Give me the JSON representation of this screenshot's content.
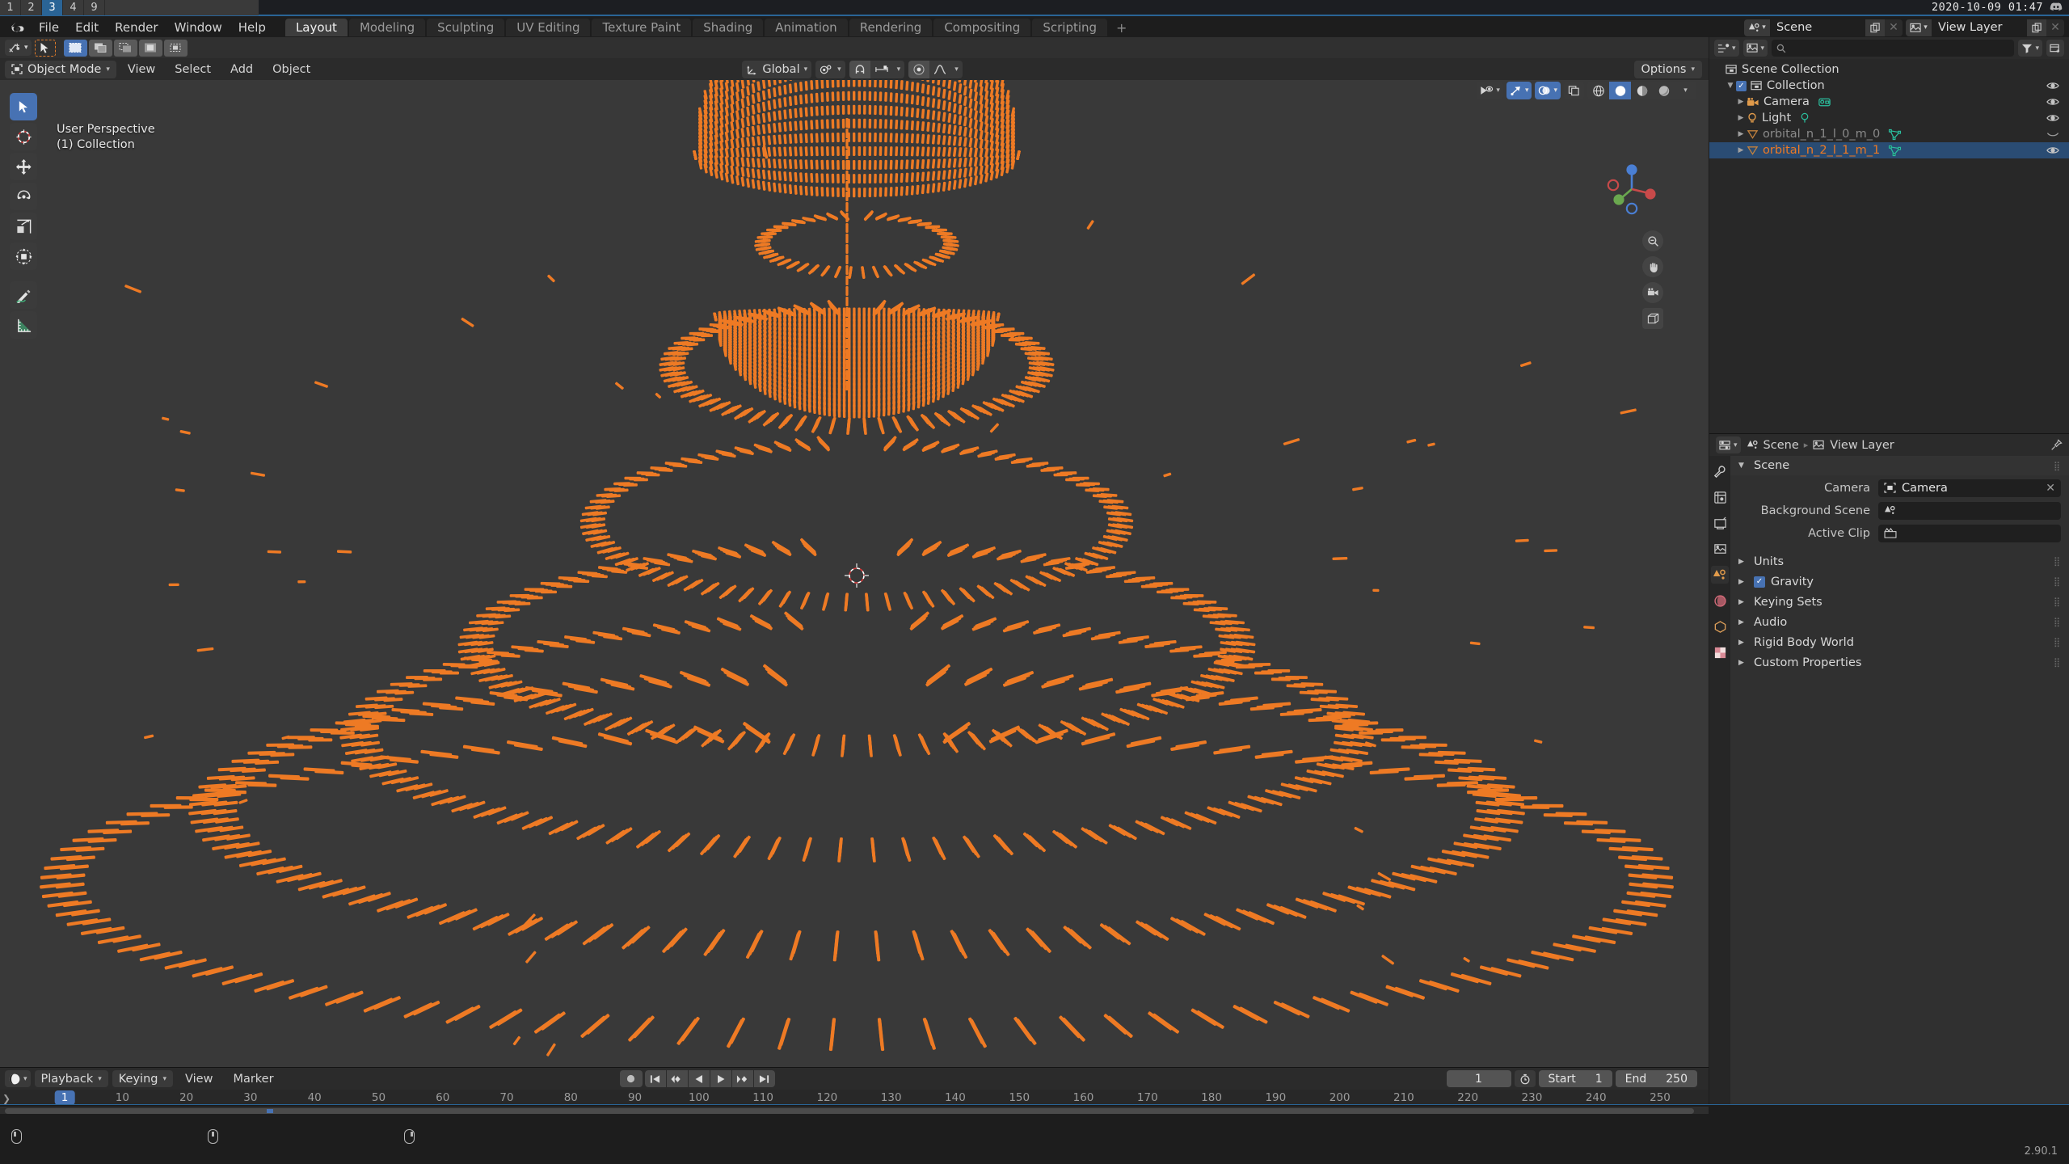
{
  "os_bar": {
    "workspaces": [
      "1",
      "2",
      "3",
      "4",
      "9"
    ],
    "active_workspace": "3",
    "clock": "2020-10-09 01:47",
    "tray_icon": "discord-icon"
  },
  "topbar": {
    "logo": "blender-logo",
    "menus": [
      "File",
      "Edit",
      "Render",
      "Window",
      "Help"
    ],
    "workspace_tabs": [
      "Layout",
      "Modeling",
      "Sculpting",
      "UV Editing",
      "Texture Paint",
      "Shading",
      "Animation",
      "Rendering",
      "Compositing",
      "Scripting"
    ],
    "active_workspace_tab": "Layout",
    "add_workspace": "+",
    "scene_selector": {
      "icon": "scene-icon",
      "value": "Scene",
      "new_btn": "duplicate-icon",
      "unlink_btn": "x-icon"
    },
    "viewlayer_selector": {
      "icon": "viewlayer-icon",
      "value": "View Layer",
      "new_btn": "duplicate-icon",
      "unlink_btn": "x-icon"
    }
  },
  "viewport": {
    "tool_row": {
      "cursor_dropdown_icon": "cursor-add-icon",
      "active_tool_icon": "tweak-cursor-icon",
      "select_modes": [
        "set-select-icon",
        "extend-select-icon",
        "subtract-select-icon",
        "invert-select-icon",
        "intersect-select-icon"
      ],
      "active_select_mode": 0
    },
    "header": {
      "mode": "Object Mode",
      "menus": [
        "View",
        "Select",
        "Add",
        "Object"
      ],
      "transform_orientation": "Global",
      "pivot_icon": "pivot-point-icon",
      "snap_icon": "magnet-icon",
      "snap_target_icon": "snap-increment-icon",
      "proportional_icon": "proportional-edit-icon",
      "falloff_icon": "smooth-falloff-icon",
      "options_label": "Options",
      "visibility_icon": "object-types-visibility-icon",
      "gizmo_icon": "gizmo-icon",
      "overlays_icon": "overlays-icon",
      "xray_icon": "xray-icon",
      "shading_modes": [
        "wireframe-icon",
        "solid-icon",
        "material-preview-icon",
        "rendered-icon"
      ],
      "active_shading_mode": 1
    },
    "overlay_text_line1": "User Perspective",
    "overlay_text_line2": "(1) Collection",
    "toolbar_tools": [
      "tweak-tool-icon",
      "cursor-tool-icon",
      "move-tool-icon",
      "rotate-tool-icon",
      "scale-tool-icon",
      "transform-tool-icon",
      "annotate-tool-icon",
      "measure-tool-icon"
    ],
    "active_toolbar_tool": 0,
    "nav_buttons": [
      "zoom-icon",
      "pan-hand-icon",
      "camera-view-icon",
      "ortho-persp-toggle-icon"
    ],
    "gizmo_axes": [
      "X",
      "Y",
      "Z"
    ],
    "object_color": "#ee7a24",
    "background_color": "#393939",
    "cursor_3d": "3d-cursor-icon"
  },
  "outliner": {
    "editor_icon": "outliner-editor-icon",
    "display_mode_icon": "view-layer-icon",
    "search_placeholder": "",
    "search_icon": "search-icon",
    "filter_icon": "filter-icon",
    "new_collection_icon": "new-collection-icon",
    "rows": [
      {
        "name": "Scene Collection",
        "icon": "scene-collection-icon",
        "indent": 0,
        "has_tri": false,
        "has_checkbox": false,
        "eye": false,
        "selected": false,
        "dim": false,
        "data_icon": ""
      },
      {
        "name": "Collection",
        "icon": "collection-icon",
        "indent": 1,
        "has_tri": true,
        "has_checkbox": true,
        "eye": true,
        "selected": false,
        "dim": false,
        "data_icon": ""
      },
      {
        "name": "Camera",
        "icon": "camera-object-icon",
        "indent": 2,
        "has_tri": true,
        "has_checkbox": false,
        "eye": true,
        "selected": false,
        "dim": false,
        "data_icon": "camera-data-icon"
      },
      {
        "name": "Light",
        "icon": "light-object-icon",
        "indent": 2,
        "has_tri": true,
        "has_checkbox": false,
        "eye": true,
        "selected": false,
        "dim": false,
        "data_icon": "light-data-icon"
      },
      {
        "name": "orbital_n_1_l_0_m_0",
        "icon": "mesh-object-icon",
        "indent": 2,
        "has_tri": true,
        "has_checkbox": false,
        "eye": false,
        "eye_closed": true,
        "selected": false,
        "dim": true,
        "data_icon": "mesh-data-icon"
      },
      {
        "name": "orbital_n_2_l_1_m_1",
        "icon": "mesh-object-icon",
        "indent": 2,
        "has_tri": true,
        "has_checkbox": false,
        "eye": true,
        "selected": true,
        "dim": false,
        "data_icon": "mesh-data-icon"
      }
    ]
  },
  "properties": {
    "editor_icon": "properties-editor-icon",
    "breadcrumb": [
      "Scene",
      "View Layer"
    ],
    "pin_icon": "pin-icon",
    "tabs": [
      "tool-tab-icon",
      "render-tab-icon",
      "output-tab-icon",
      "viewlayer-tab-icon",
      "scene-tab-icon",
      "world-tab-icon",
      "object-tab-icon",
      "texture-tab-icon"
    ],
    "active_tab": 4,
    "panel_title": "Scene",
    "fields": [
      {
        "label": "Camera",
        "value": "Camera",
        "icon": "camera-data-icon",
        "clear": "x-icon"
      },
      {
        "label": "Background Scene",
        "value": "",
        "icon": "scene-icon",
        "clear": ""
      },
      {
        "label": "Active Clip",
        "value": "",
        "icon": "movie-clip-icon",
        "clear": ""
      }
    ],
    "panels": [
      {
        "label": "Units",
        "checkbox": false
      },
      {
        "label": "Gravity",
        "checkbox": true,
        "checked": true
      },
      {
        "label": "Keying Sets",
        "checkbox": false
      },
      {
        "label": "Audio",
        "checkbox": false
      },
      {
        "label": "Rigid Body World",
        "checkbox": false
      },
      {
        "label": "Custom Properties",
        "checkbox": false
      }
    ]
  },
  "timeline": {
    "editor_icon": "timeline-editor-icon",
    "dropdowns": [
      "Playback",
      "Keying"
    ],
    "menus": [
      "View",
      "Marker"
    ],
    "playback_buttons": [
      "record-icon",
      "jump-start-icon",
      "prev-keyframe-icon",
      "play-reverse-icon",
      "play-icon",
      "next-keyframe-icon",
      "jump-end-icon"
    ],
    "current_frame": "1",
    "auto_key_icon": "auto-keyframe-icon",
    "start_label": "Start",
    "start_value": "1",
    "end_label": "End",
    "end_value": "250",
    "ruler_ticks": [
      "10",
      "20",
      "30",
      "40",
      "50",
      "60",
      "70",
      "80",
      "90",
      "100",
      "110",
      "120",
      "130",
      "140",
      "150",
      "160",
      "170",
      "180",
      "190",
      "200",
      "210",
      "220",
      "230",
      "240",
      "250"
    ],
    "playhead_frame": "1"
  },
  "statusbar": {
    "hints": [
      {
        "icon": "mouse-left-icon",
        "text": ""
      },
      {
        "icon": "mouse-middle-icon",
        "text": ""
      },
      {
        "icon": "mouse-right-icon",
        "text": ""
      }
    ],
    "version": "2.90.1"
  },
  "colors": {
    "accent_blue": "#4772b3",
    "selection_orange": "#ee7a24",
    "viewport_bg": "#393939",
    "panel_bg": "#303030",
    "header_bg": "#2b2b2b"
  }
}
